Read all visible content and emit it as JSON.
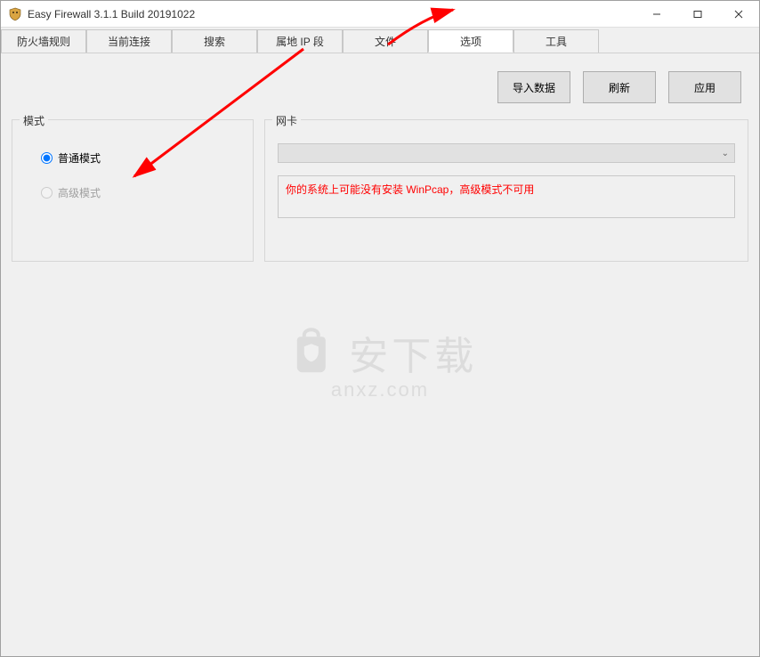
{
  "window": {
    "title": "Easy Firewall 3.1.1 Build 20191022"
  },
  "tabs": [
    {
      "label": "防火墙规则"
    },
    {
      "label": "当前连接"
    },
    {
      "label": "搜索"
    },
    {
      "label": "属地 IP 段"
    },
    {
      "label": "文件"
    },
    {
      "label": "选项"
    },
    {
      "label": "工具"
    }
  ],
  "activeTab": "选项",
  "toolbar": {
    "import_label": "导入数据",
    "refresh_label": "刷新",
    "apply_label": "应用"
  },
  "mode": {
    "legend": "模式",
    "normal_label": "普通模式",
    "advanced_label": "高级模式",
    "selected": "normal",
    "advanced_disabled": true
  },
  "net": {
    "legend": "网卡",
    "selected": "",
    "status_msg": "你的系统上可能没有安装 WinPcap，高级模式不可用"
  },
  "watermark": {
    "brand": "安下载",
    "domain": "anxz.com"
  }
}
